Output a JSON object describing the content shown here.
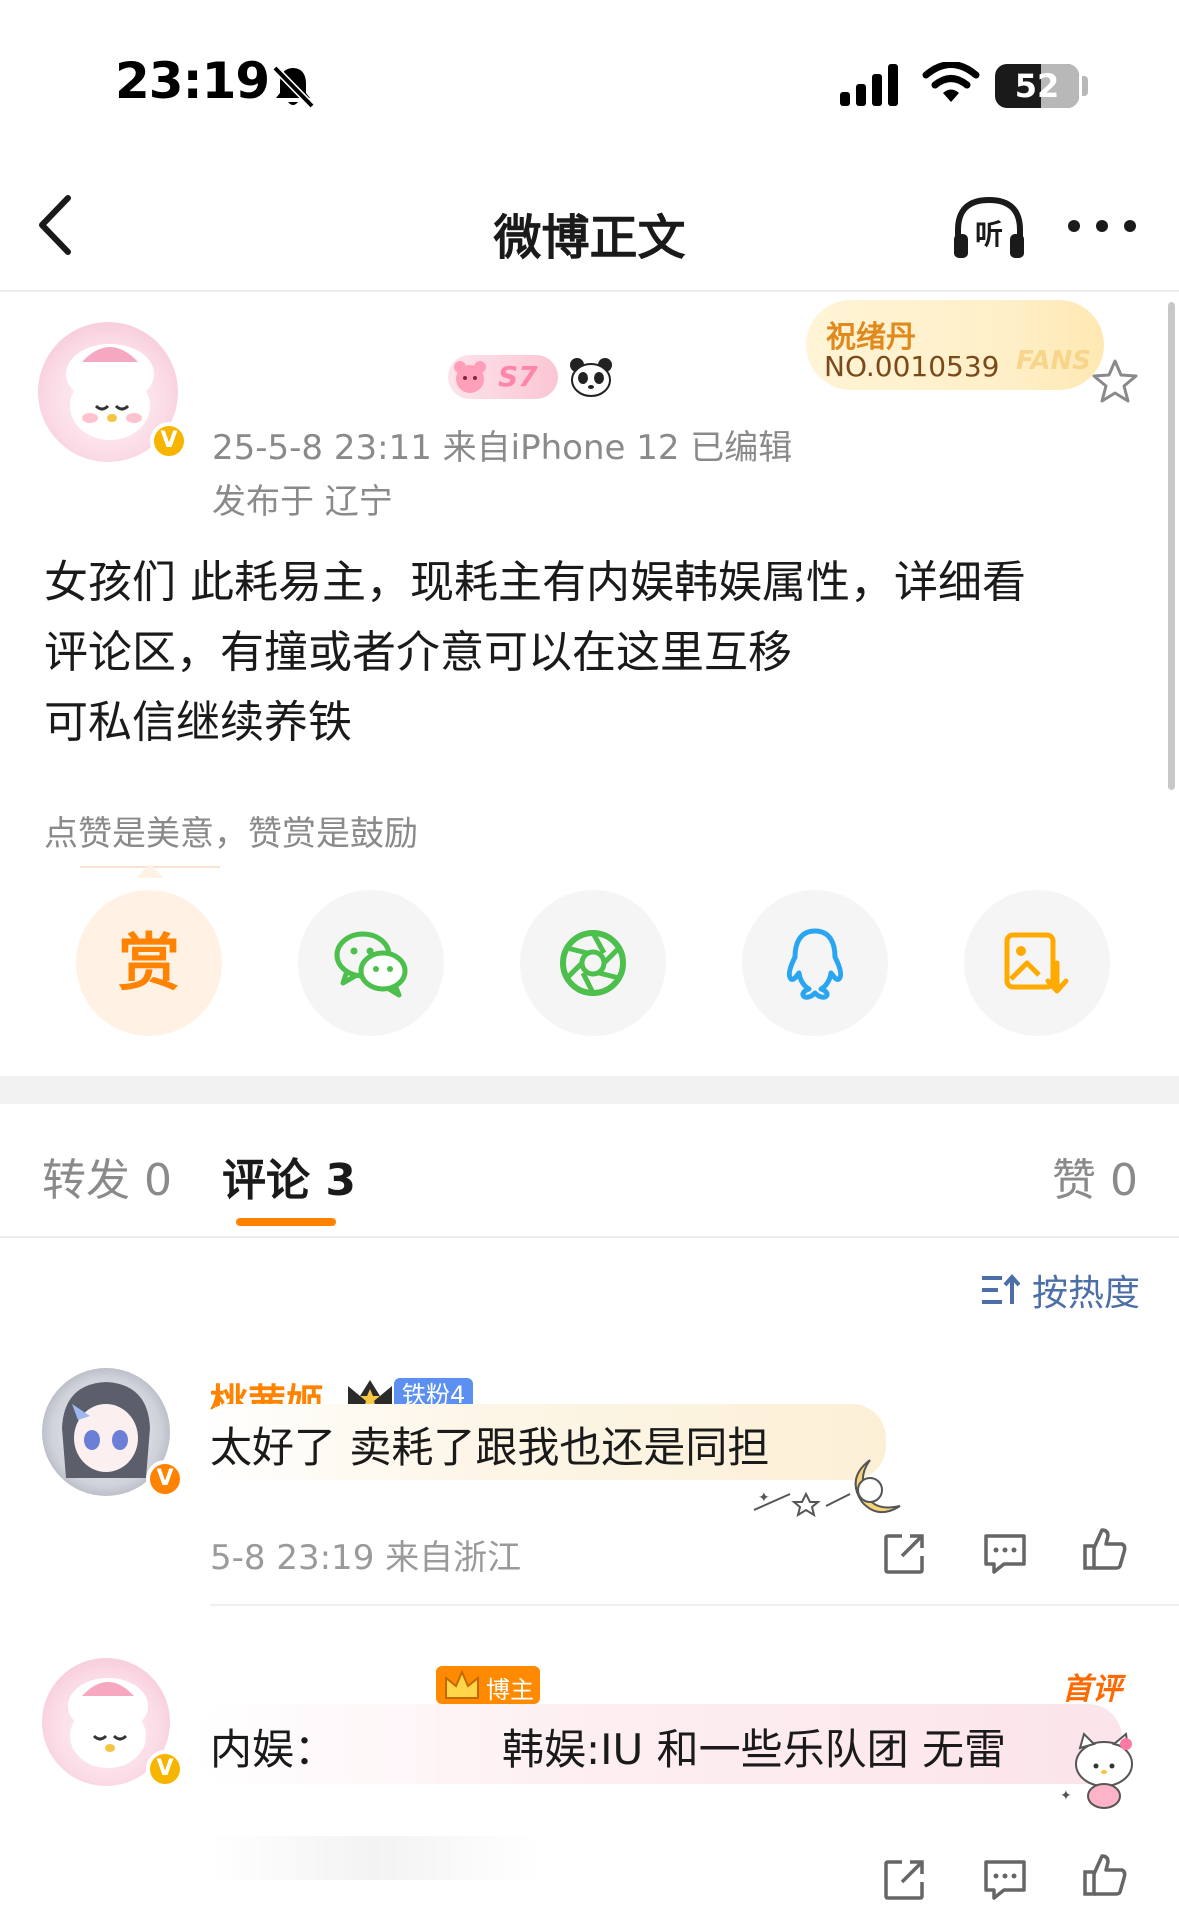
{
  "status_bar": {
    "time": "23:19",
    "battery_level": "52",
    "icons": [
      "bell-slash-icon",
      "signal-icon",
      "wifi-icon",
      "battery-icon"
    ]
  },
  "nav": {
    "title": "微博正文",
    "listen_label": "听",
    "icons": [
      "back-chevron-icon",
      "headphones-icon",
      "more-icon"
    ]
  },
  "post": {
    "medal_label": "S7",
    "fans_card": {
      "name": "祝绪丹",
      "number": "NO.0010539",
      "label": "FANS"
    },
    "meta": "25-5-8 23:11  来自iPhone 12  已编辑",
    "location": "发布于 辽宁",
    "body_lines": [
      "女孩们 此耗易主，现耗主有内娱韩娱属性，详细看",
      "评论区，有撞或者介意可以在这里互移",
      "可私信继续养铁"
    ]
  },
  "reward": {
    "caption": "点赞是美意，赞赏是鼓励",
    "reward_label": "赏",
    "share_targets": [
      "wechat-icon",
      "moments-icon",
      "qq-icon",
      "save-image-icon"
    ]
  },
  "tabs": [
    {
      "label": "转发",
      "count": "0"
    },
    {
      "label": "评论",
      "count": "3"
    },
    {
      "label": "赞",
      "count": "0"
    }
  ],
  "sort": {
    "label": "按热度"
  },
  "comments": [
    {
      "name": "桃茜姬",
      "fan_badge": "铁粉4",
      "text": "太好了 卖耗了跟我也还是同担",
      "meta": "5-8 23:19 来自浙江"
    },
    {
      "blogger_badge": "博主",
      "first_label": "首评",
      "text_left": "内娱：",
      "text_right": "韩娱:IU 和一些乐队团 无雷"
    }
  ],
  "colors": {
    "accent": "#ff8200",
    "link_blue": "#4d6fa8",
    "text_gray": "#8a8a8a",
    "verify_gold": "#f7b500",
    "wechat_green": "#4cbf4c",
    "qq_blue": "#2aa5f2"
  }
}
